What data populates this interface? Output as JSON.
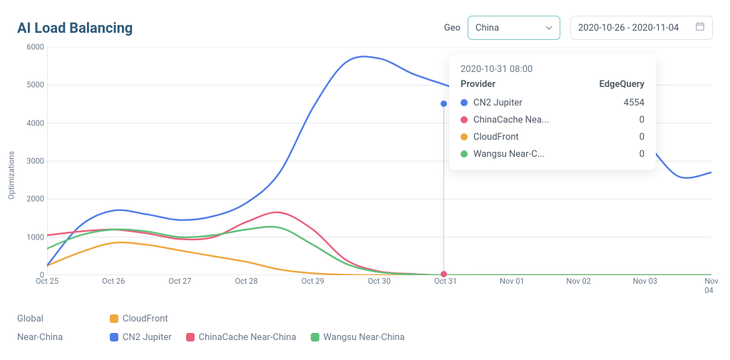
{
  "header": {
    "title": "AI Load Balancing",
    "geo_label": "Geo",
    "geo_value": "China",
    "date_range": "2020-10-26 - 2020-11-04"
  },
  "chart_data": {
    "type": "line",
    "ylabel": "Optimizations",
    "ylim": [
      0,
      6000
    ],
    "yticks": [
      0,
      1000,
      2000,
      3000,
      4000,
      5000,
      6000
    ],
    "xticks": [
      "Oct 25",
      "Oct 26",
      "Oct 27",
      "Oct 28",
      "Oct 29",
      "Oct 30",
      "Oct 31",
      "Nov 01",
      "Nov 02",
      "Nov 03",
      "Nov 04"
    ],
    "x": [
      "Oct 25",
      "Oct 25.5",
      "Oct 26",
      "Oct 26.5",
      "Oct 27",
      "Oct 27.5",
      "Oct 28",
      "Oct 28.5",
      "Oct 29",
      "Oct 29.5",
      "Oct 30",
      "Oct 30.5",
      "Oct 31",
      "Oct 31.5",
      "Nov 01",
      "Nov 01.5",
      "Nov 02",
      "Nov 02.5",
      "Nov 03",
      "Nov 03.5",
      "Nov 04"
    ],
    "series": [
      {
        "name": "CloudFront",
        "color": "#f0a63e",
        "group": "Global",
        "values": [
          250,
          600,
          850,
          800,
          650,
          500,
          350,
          150,
          50,
          10,
          0,
          0,
          0,
          0,
          0,
          0,
          0,
          0,
          0,
          0,
          0
        ]
      },
      {
        "name": "CN2 Jupiter",
        "color": "#4f7de8",
        "group": "Near-China",
        "values": [
          250,
          1300,
          1700,
          1600,
          1450,
          1550,
          1900,
          2700,
          4400,
          5600,
          5700,
          5300,
          5000,
          4700,
          4550,
          4500,
          4300,
          4100,
          3500,
          2600,
          2700,
          2850
        ]
      },
      {
        "name": "ChinaCache Near-China",
        "color": "#e85f7b",
        "group": "Near-China",
        "values": [
          1050,
          1150,
          1200,
          1100,
          950,
          1000,
          1400,
          1650,
          1200,
          400,
          100,
          30,
          0,
          0,
          0,
          0,
          0,
          0,
          0,
          0,
          0
        ]
      },
      {
        "name": "Wangsu Near-China",
        "color": "#5fbf7a",
        "group": "Near-China",
        "values": [
          700,
          1050,
          1200,
          1150,
          1000,
          1050,
          1200,
          1250,
          800,
          300,
          80,
          20,
          0,
          0,
          0,
          0,
          0,
          0,
          0,
          0,
          0
        ]
      }
    ]
  },
  "tooltip": {
    "timestamp": "2020-10-31 08:00",
    "col_provider": "Provider",
    "col_value": "EdgeQuery",
    "rows": [
      {
        "color": "#4f7de8",
        "name": "CN2 Jupiter",
        "value": 4554
      },
      {
        "color": "#e85f7b",
        "name": "ChinaCache Nea...",
        "value": 0
      },
      {
        "color": "#f0a63e",
        "name": "CloudFront",
        "value": 0
      },
      {
        "color": "#5fbf7a",
        "name": "Wangsu Near-C...",
        "value": 0
      }
    ]
  },
  "legend": {
    "groups": [
      {
        "label": "Global",
        "items": [
          {
            "color": "#f0a63e",
            "name": "CloudFront"
          }
        ]
      },
      {
        "label": "Near-China",
        "items": [
          {
            "color": "#4f7de8",
            "name": "CN2 Jupiter"
          },
          {
            "color": "#e85f7b",
            "name": "ChinaCache Near-China"
          },
          {
            "color": "#5fbf7a",
            "name": "Wangsu Near-China"
          }
        ]
      }
    ]
  }
}
